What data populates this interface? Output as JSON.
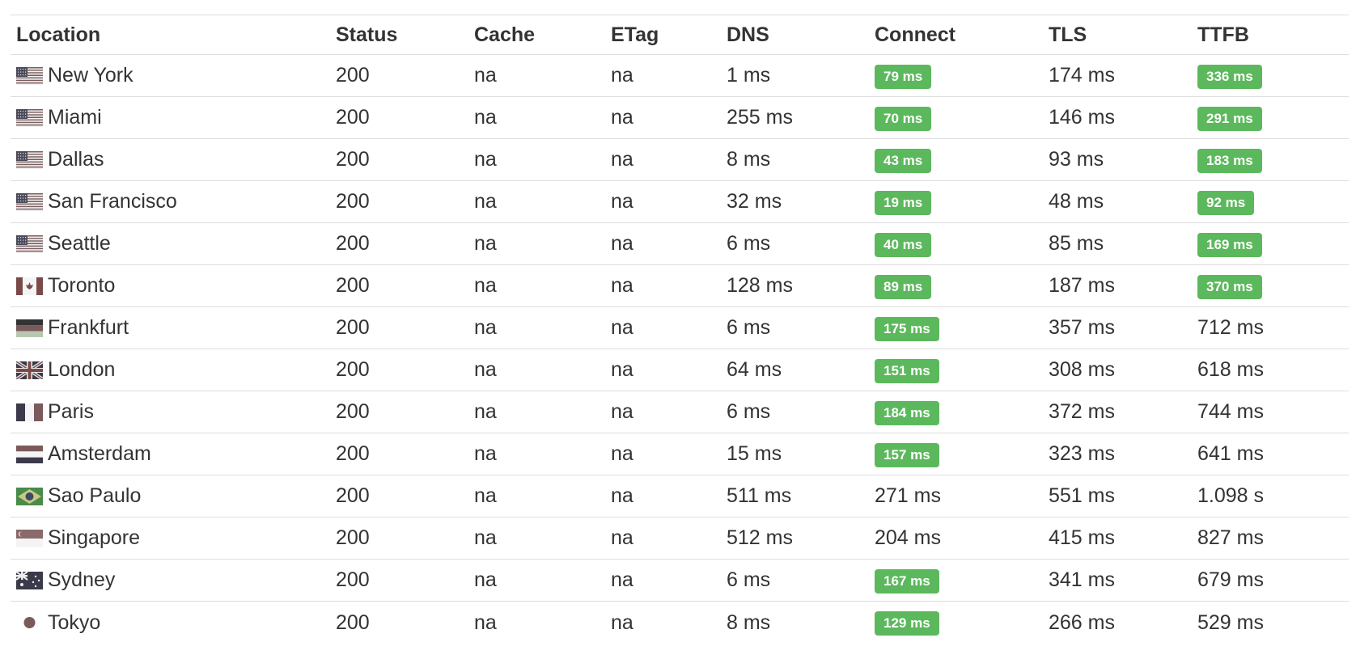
{
  "columns": {
    "location": "Location",
    "status": "Status",
    "cache": "Cache",
    "etag": "ETag",
    "dns": "DNS",
    "connect": "Connect",
    "tls": "TLS",
    "ttfb": "TTFB"
  },
  "colors": {
    "badge_green": "#5cb85c",
    "text": "#333333",
    "divider": "#dddddd"
  },
  "rows": [
    {
      "location": "New York",
      "flag": "us-flag-icon",
      "status": "200",
      "cache": "na",
      "etag": "na",
      "dns": "1 ms",
      "connect": "79 ms",
      "connect_badge": true,
      "tls": "174 ms",
      "ttfb": "336 ms",
      "ttfb_badge": true
    },
    {
      "location": "Miami",
      "flag": "us-flag-icon",
      "status": "200",
      "cache": "na",
      "etag": "na",
      "dns": "255 ms",
      "connect": "70 ms",
      "connect_badge": true,
      "tls": "146 ms",
      "ttfb": "291 ms",
      "ttfb_badge": true
    },
    {
      "location": "Dallas",
      "flag": "us-flag-icon",
      "status": "200",
      "cache": "na",
      "etag": "na",
      "dns": "8 ms",
      "connect": "43 ms",
      "connect_badge": true,
      "tls": "93 ms",
      "ttfb": "183 ms",
      "ttfb_badge": true
    },
    {
      "location": "San Francisco",
      "flag": "us-flag-icon",
      "status": "200",
      "cache": "na",
      "etag": "na",
      "dns": "32 ms",
      "connect": "19 ms",
      "connect_badge": true,
      "tls": "48 ms",
      "ttfb": "92 ms",
      "ttfb_badge": true
    },
    {
      "location": "Seattle",
      "flag": "us-flag-icon",
      "status": "200",
      "cache": "na",
      "etag": "na",
      "dns": "6 ms",
      "connect": "40 ms",
      "connect_badge": true,
      "tls": "85 ms",
      "ttfb": "169 ms",
      "ttfb_badge": true
    },
    {
      "location": "Toronto",
      "flag": "canada-flag-icon",
      "status": "200",
      "cache": "na",
      "etag": "na",
      "dns": "128 ms",
      "connect": "89 ms",
      "connect_badge": true,
      "tls": "187 ms",
      "ttfb": "370 ms",
      "ttfb_badge": true
    },
    {
      "location": "Frankfurt",
      "flag": "germany-flag-icon",
      "status": "200",
      "cache": "na",
      "etag": "na",
      "dns": "6 ms",
      "connect": "175 ms",
      "connect_badge": true,
      "tls": "357 ms",
      "ttfb": "712 ms",
      "ttfb_badge": false
    },
    {
      "location": "London",
      "flag": "uk-flag-icon",
      "status": "200",
      "cache": "na",
      "etag": "na",
      "dns": "64 ms",
      "connect": "151 ms",
      "connect_badge": true,
      "tls": "308 ms",
      "ttfb": "618 ms",
      "ttfb_badge": false
    },
    {
      "location": "Paris",
      "flag": "france-flag-icon",
      "status": "200",
      "cache": "na",
      "etag": "na",
      "dns": "6 ms",
      "connect": "184 ms",
      "connect_badge": true,
      "tls": "372 ms",
      "ttfb": "744 ms",
      "ttfb_badge": false
    },
    {
      "location": "Amsterdam",
      "flag": "netherlands-flag-icon",
      "status": "200",
      "cache": "na",
      "etag": "na",
      "dns": "15 ms",
      "connect": "157 ms",
      "connect_badge": true,
      "tls": "323 ms",
      "ttfb": "641 ms",
      "ttfb_badge": false
    },
    {
      "location": "Sao Paulo",
      "flag": "brazil-flag-icon",
      "status": "200",
      "cache": "na",
      "etag": "na",
      "dns": "511 ms",
      "connect": "271 ms",
      "connect_badge": false,
      "tls": "551 ms",
      "ttfb": "1.098 s",
      "ttfb_badge": false
    },
    {
      "location": "Singapore",
      "flag": "singapore-flag-icon",
      "status": "200",
      "cache": "na",
      "etag": "na",
      "dns": "512 ms",
      "connect": "204 ms",
      "connect_badge": false,
      "tls": "415 ms",
      "ttfb": "827 ms",
      "ttfb_badge": false
    },
    {
      "location": "Sydney",
      "flag": "australia-flag-icon",
      "status": "200",
      "cache": "na",
      "etag": "na",
      "dns": "6 ms",
      "connect": "167 ms",
      "connect_badge": true,
      "tls": "341 ms",
      "ttfb": "679 ms",
      "ttfb_badge": false
    },
    {
      "location": "Tokyo",
      "flag": "japan-flag-icon",
      "status": "200",
      "cache": "na",
      "etag": "na",
      "dns": "8 ms",
      "connect": "129 ms",
      "connect_badge": true,
      "tls": "266 ms",
      "ttfb": "529 ms",
      "ttfb_badge": false
    }
  ]
}
